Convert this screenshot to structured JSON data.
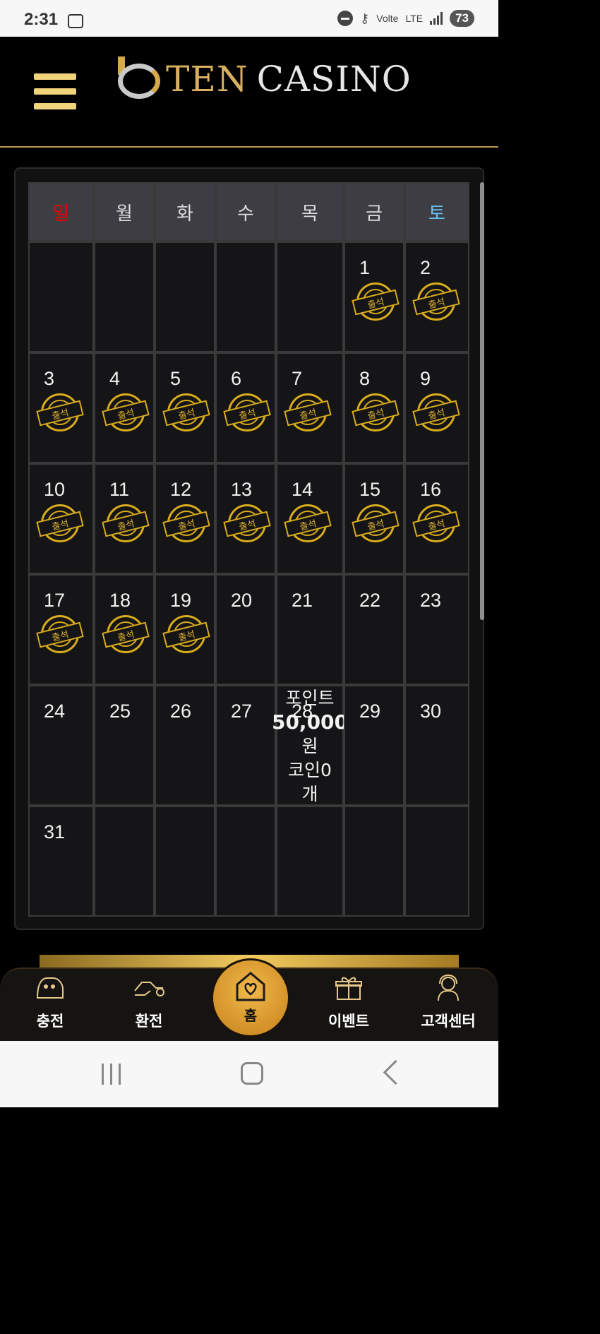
{
  "status_bar": {
    "time": "2:31",
    "battery": "73",
    "network_label": "LTE",
    "volte_label": "Volte"
  },
  "header": {
    "brand_first": "Ten",
    "brand_second": "Casino"
  },
  "calendar": {
    "weekday_labels": [
      "일",
      "월",
      "화",
      "수",
      "목",
      "금",
      "토"
    ],
    "stamp_label": "출석",
    "weeks": [
      [
        null,
        null,
        null,
        null,
        null,
        {
          "day": "1",
          "attended": true
        },
        {
          "day": "2",
          "attended": true
        }
      ],
      [
        {
          "day": "3",
          "attended": true
        },
        {
          "day": "4",
          "attended": true
        },
        {
          "day": "5",
          "attended": true
        },
        {
          "day": "6",
          "attended": true
        },
        {
          "day": "7",
          "attended": true
        },
        {
          "day": "8",
          "attended": true
        },
        {
          "day": "9",
          "attended": true
        }
      ],
      [
        {
          "day": "10",
          "attended": true
        },
        {
          "day": "11",
          "attended": true
        },
        {
          "day": "12",
          "attended": true
        },
        {
          "day": "13",
          "attended": true
        },
        {
          "day": "14",
          "attended": true
        },
        {
          "day": "15",
          "attended": true
        },
        {
          "day": "16",
          "attended": true
        }
      ],
      [
        {
          "day": "17",
          "attended": true
        },
        {
          "day": "18",
          "attended": true
        },
        {
          "day": "19",
          "attended": true
        },
        {
          "day": "20",
          "attended": false
        },
        {
          "day": "21",
          "attended": false
        },
        {
          "day": "22",
          "attended": false
        },
        {
          "day": "23",
          "attended": false
        }
      ],
      [
        {
          "day": "24",
          "attended": false
        },
        {
          "day": "25",
          "attended": false
        },
        {
          "day": "26",
          "attended": false
        },
        {
          "day": "27",
          "attended": false
        },
        {
          "day": "28",
          "attended": false
        },
        {
          "day": "29",
          "attended": false
        },
        {
          "day": "30",
          "attended": false
        }
      ],
      [
        {
          "day": "31",
          "attended": false
        },
        null,
        null,
        null,
        null,
        null,
        null
      ]
    ],
    "reward_overlay": {
      "line1": "포인트",
      "line2": "50,000",
      "line3": "원",
      "line4": "코인0",
      "line5": "개"
    }
  },
  "bottom_nav": {
    "items": [
      {
        "label": "충전",
        "icon": "charge-icon"
      },
      {
        "label": "환전",
        "icon": "exchange-icon"
      },
      {
        "label": "홈",
        "icon": "home-icon"
      },
      {
        "label": "이벤트",
        "icon": "gift-icon"
      },
      {
        "label": "고객센터",
        "icon": "support-icon"
      }
    ]
  }
}
